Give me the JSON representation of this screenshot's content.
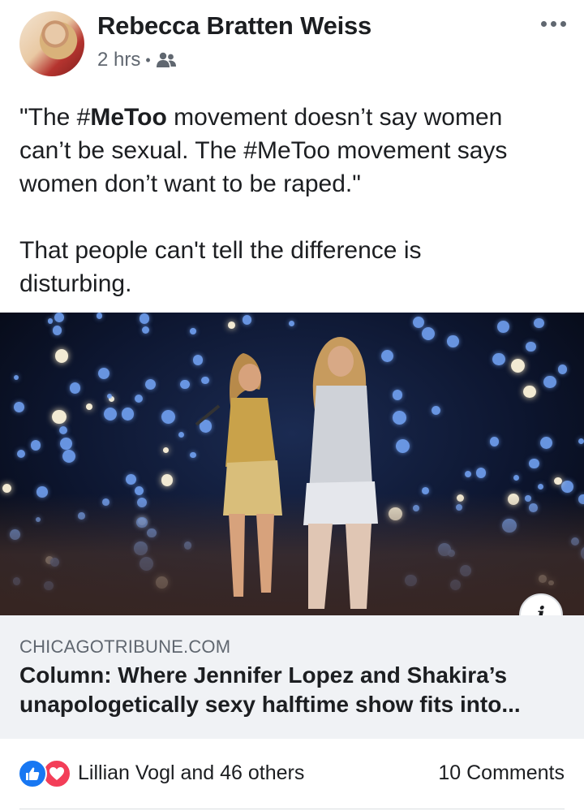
{
  "post": {
    "author": "Rebecca Bratten Weiss",
    "time": "2 hrs",
    "separator": "•",
    "audience_icon": "friends-icon",
    "more_icon": "more-horizontal-icon",
    "text": {
      "line1_pre": "\"The #",
      "line1_bold": "MeToo",
      "line1_post": " movement doesn’t say women",
      "line2": "can’t be sexual. The #MeToo movement says",
      "line3": "women don’t want to be raped.\"",
      "para2_line1": "That people can't tell the difference is",
      "para2_line2": "disturbing."
    }
  },
  "link": {
    "domain": "CHICAGOTRIBUNE.COM",
    "title_line1": "Column: Where Jennifer Lopez and Shakira’s",
    "title_line2": "unapologetically sexy halftime show fits into...",
    "info_label": "i"
  },
  "engagement": {
    "reactions": [
      "like-icon",
      "love-icon"
    ],
    "reactors": "Lillian Vogl and 46 others",
    "comments": "10 Comments"
  },
  "colors": {
    "like": "#1877f2",
    "love": "#f33e58",
    "caption_bg": "#f0f2f5",
    "meta_text": "#606770"
  }
}
